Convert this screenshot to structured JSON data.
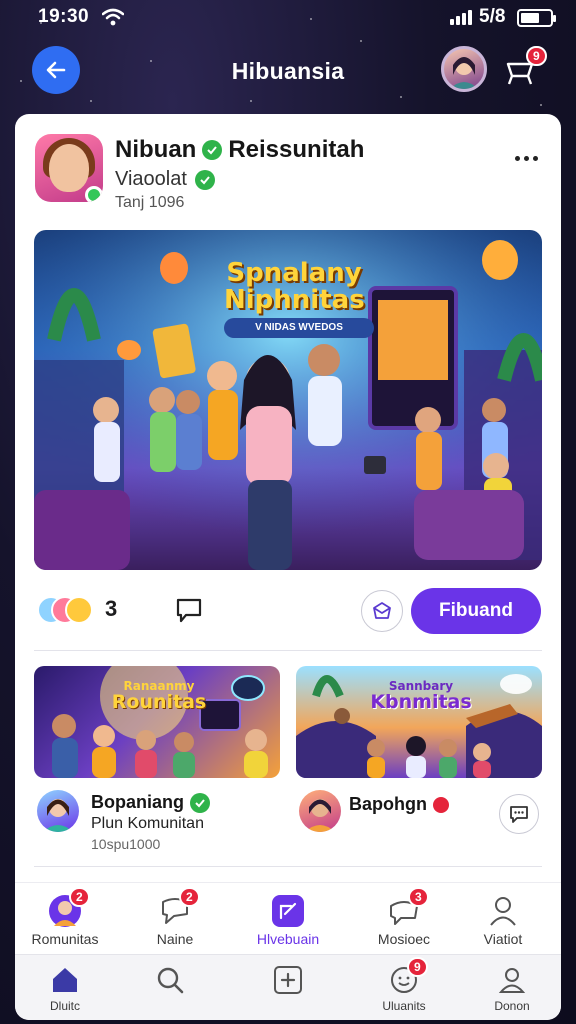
{
  "status_bar": {
    "time": "19:30",
    "battery_text": "5/8"
  },
  "header": {
    "title": "Hibuansia",
    "cart_badge": "9"
  },
  "post": {
    "author_name": "Nibuan",
    "community_name": "Reissunitah",
    "subtitle": "Viaoolat",
    "date": "Tanj 1096",
    "hero": {
      "title_line1": "Spnalany",
      "title_line2": "Niphnitas",
      "subtitle": "V NIDAS WVEDOS"
    },
    "reaction_count": "3",
    "follow_label": "Fibuand"
  },
  "related": [
    {
      "banner_line1": "Ranaanmy",
      "banner_line2": "Rounitas",
      "author_name": "Bopaniang",
      "line": "Plun Komunitan",
      "date": "10spu1000"
    },
    {
      "banner_line1": "Sannbary",
      "banner_line2": "Kbnmitas",
      "author_name": "Bapohgn"
    }
  ],
  "tabs_top": [
    {
      "label": "Romunitas",
      "icon": "community-avatar-icon",
      "badge": "2"
    },
    {
      "label": "Naine",
      "icon": "chat-bubble-icon",
      "badge": "2"
    },
    {
      "label": "Hlvebuain",
      "icon": "create-post-icon",
      "active": true
    },
    {
      "label": "Mosioec",
      "icon": "message-icon",
      "badge": "3"
    },
    {
      "label": "Viatiot",
      "icon": "profile-icon"
    }
  ],
  "tabs_bottom": [
    {
      "label": "Dluitc",
      "icon": "home-icon"
    },
    {
      "label": "",
      "icon": "search-icon"
    },
    {
      "label": "",
      "icon": "add-icon"
    },
    {
      "label": "Uluanits",
      "icon": "notification-icon",
      "badge": "9"
    },
    {
      "label": "Donon",
      "icon": "account-icon"
    }
  ],
  "colors": {
    "accent": "#6a34e8",
    "back_button": "#2f6df2",
    "badge": "#e5243b",
    "verified": "#2fb34a"
  }
}
